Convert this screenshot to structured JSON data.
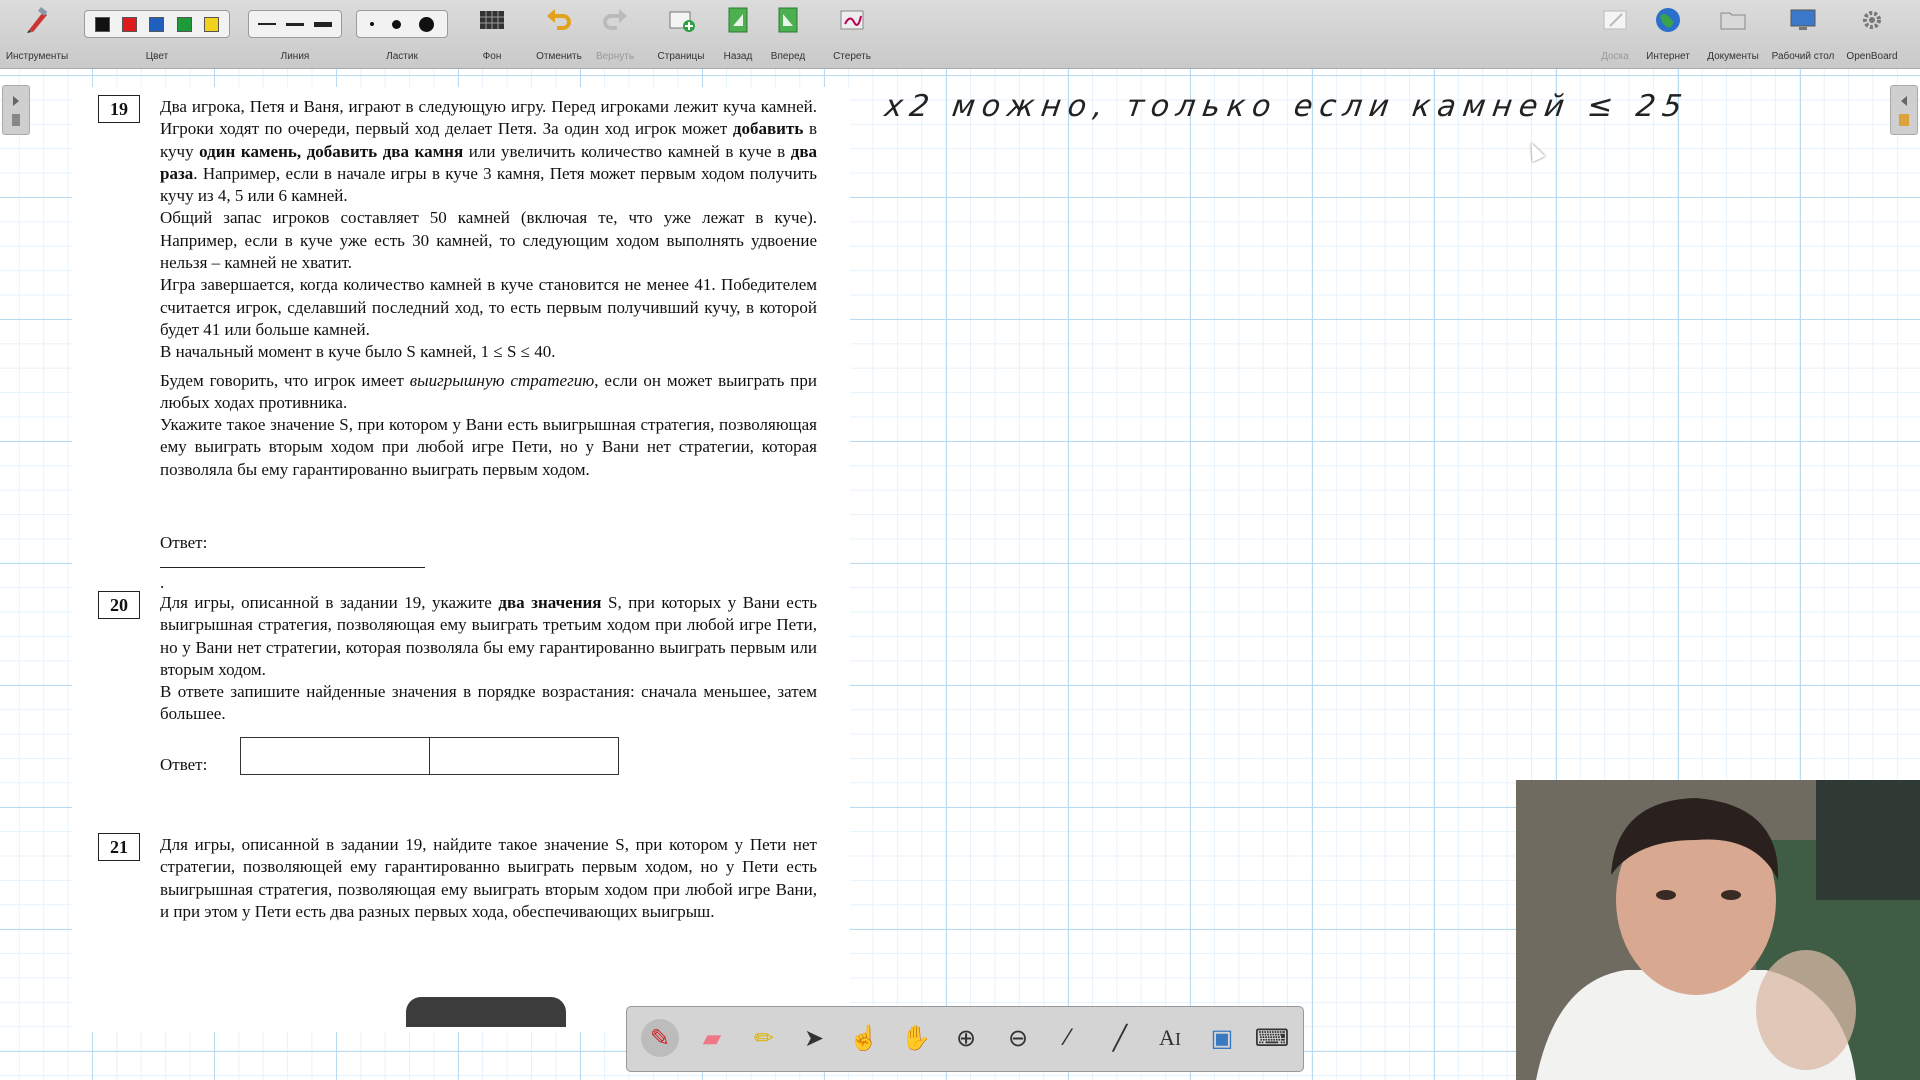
{
  "toolbar": {
    "tools_label": "Инструменты",
    "color_label": "Цвет",
    "line_label": "Линия",
    "eraser_label": "Ластик",
    "background_label": "Фон",
    "undo_label": "Отменить",
    "redo_label": "Вернуть",
    "pages_label": "Страницы",
    "back_label": "Назад",
    "forward_label": "Вперед",
    "erase_label": "Стереть",
    "board_label": "Доска",
    "internet_label": "Интернет",
    "documents_label": "Документы",
    "desktop_label": "Рабочий стол",
    "openboard_label": "OpenBoard",
    "colors": [
      "#111111",
      "#e01b1b",
      "#1f5fbf",
      "#1f9a3a",
      "#f2d21b"
    ]
  },
  "handwriting": "x2 можно, только если камней ≤ 25",
  "task19": {
    "number": "19",
    "p1_a": "Два игрока, Петя и Ваня, играют в следующую игру. Перед игроками лежит куча камней. Игроки ходят по очереди, первый ход делает Петя. За один ход игрок может ",
    "p1_b1": "добавить",
    "p1_c": " в кучу ",
    "p1_b2": "один камень, добавить два камня",
    "p1_d": " или увеличить количество камней в куче в ",
    "p1_b3": "два раза",
    "p1_e": ". Например, если в начале игры в куче 3 камня, Петя может первым ходом получить кучу из 4, 5 или 6 камней.",
    "p2": "Общий запас игроков составляет 50 камней (включая те, что уже лежат в куче). Например, если в куче уже есть 30 камней, то следующим ходом выполнять удвоение нельзя – камней не хватит.",
    "p3": "Игра завершается, когда количество камней в куче становится не менее 41. Победителем считается игрок, сделавший последний ход, то есть первым получивший кучу, в которой будет 41 или больше камней.",
    "p4": "В начальный момент в куче было S камней, 1 ≤ S ≤ 40.",
    "p5_a": "Будем говорить, что игрок имеет ",
    "p5_i": "выигрышную стратегию",
    "p5_b": ", если он может выиграть при любых ходах противника.",
    "p6": "Укажите такое значение S, при котором у Вани есть выигрышная стратегия, позволяющая ему выиграть вторым ходом при любой игре Пети, но у Вани нет стратегии, которая позволяла бы ему гарантированно выиграть первым ходом.",
    "answer_label": "Ответ:",
    "answer_end": "."
  },
  "task20": {
    "number": "20",
    "p1_a": "Для игры, описанной в задании 19, укажите ",
    "p1_b": "два значения",
    "p1_c": " S, при которых у Вани есть выигрышная стратегия, позволяющая ему выиграть третьим ходом при любой игре Пети, но у Вани нет стратегии, которая позволяла бы ему гарантированно выиграть первым или вторым ходом.",
    "p2": "В ответе запишите найденные значения в порядке возрастания: сначала меньшее, затем большее.",
    "answer_label": "Ответ:"
  },
  "task21": {
    "number": "21",
    "p1": "Для игры, описанной в задании 19, найдите такое значение S, при котором у Пети нет стратегии, позволяющей ему гарантированно выиграть первым ходом, но у Пети есть выигрышная стратегия, позволяющая ему выиграть вторым ходом при любой игре Вани, и при этом у Пети есть два разных первых хода, обеспечивающих выигрыш."
  }
}
